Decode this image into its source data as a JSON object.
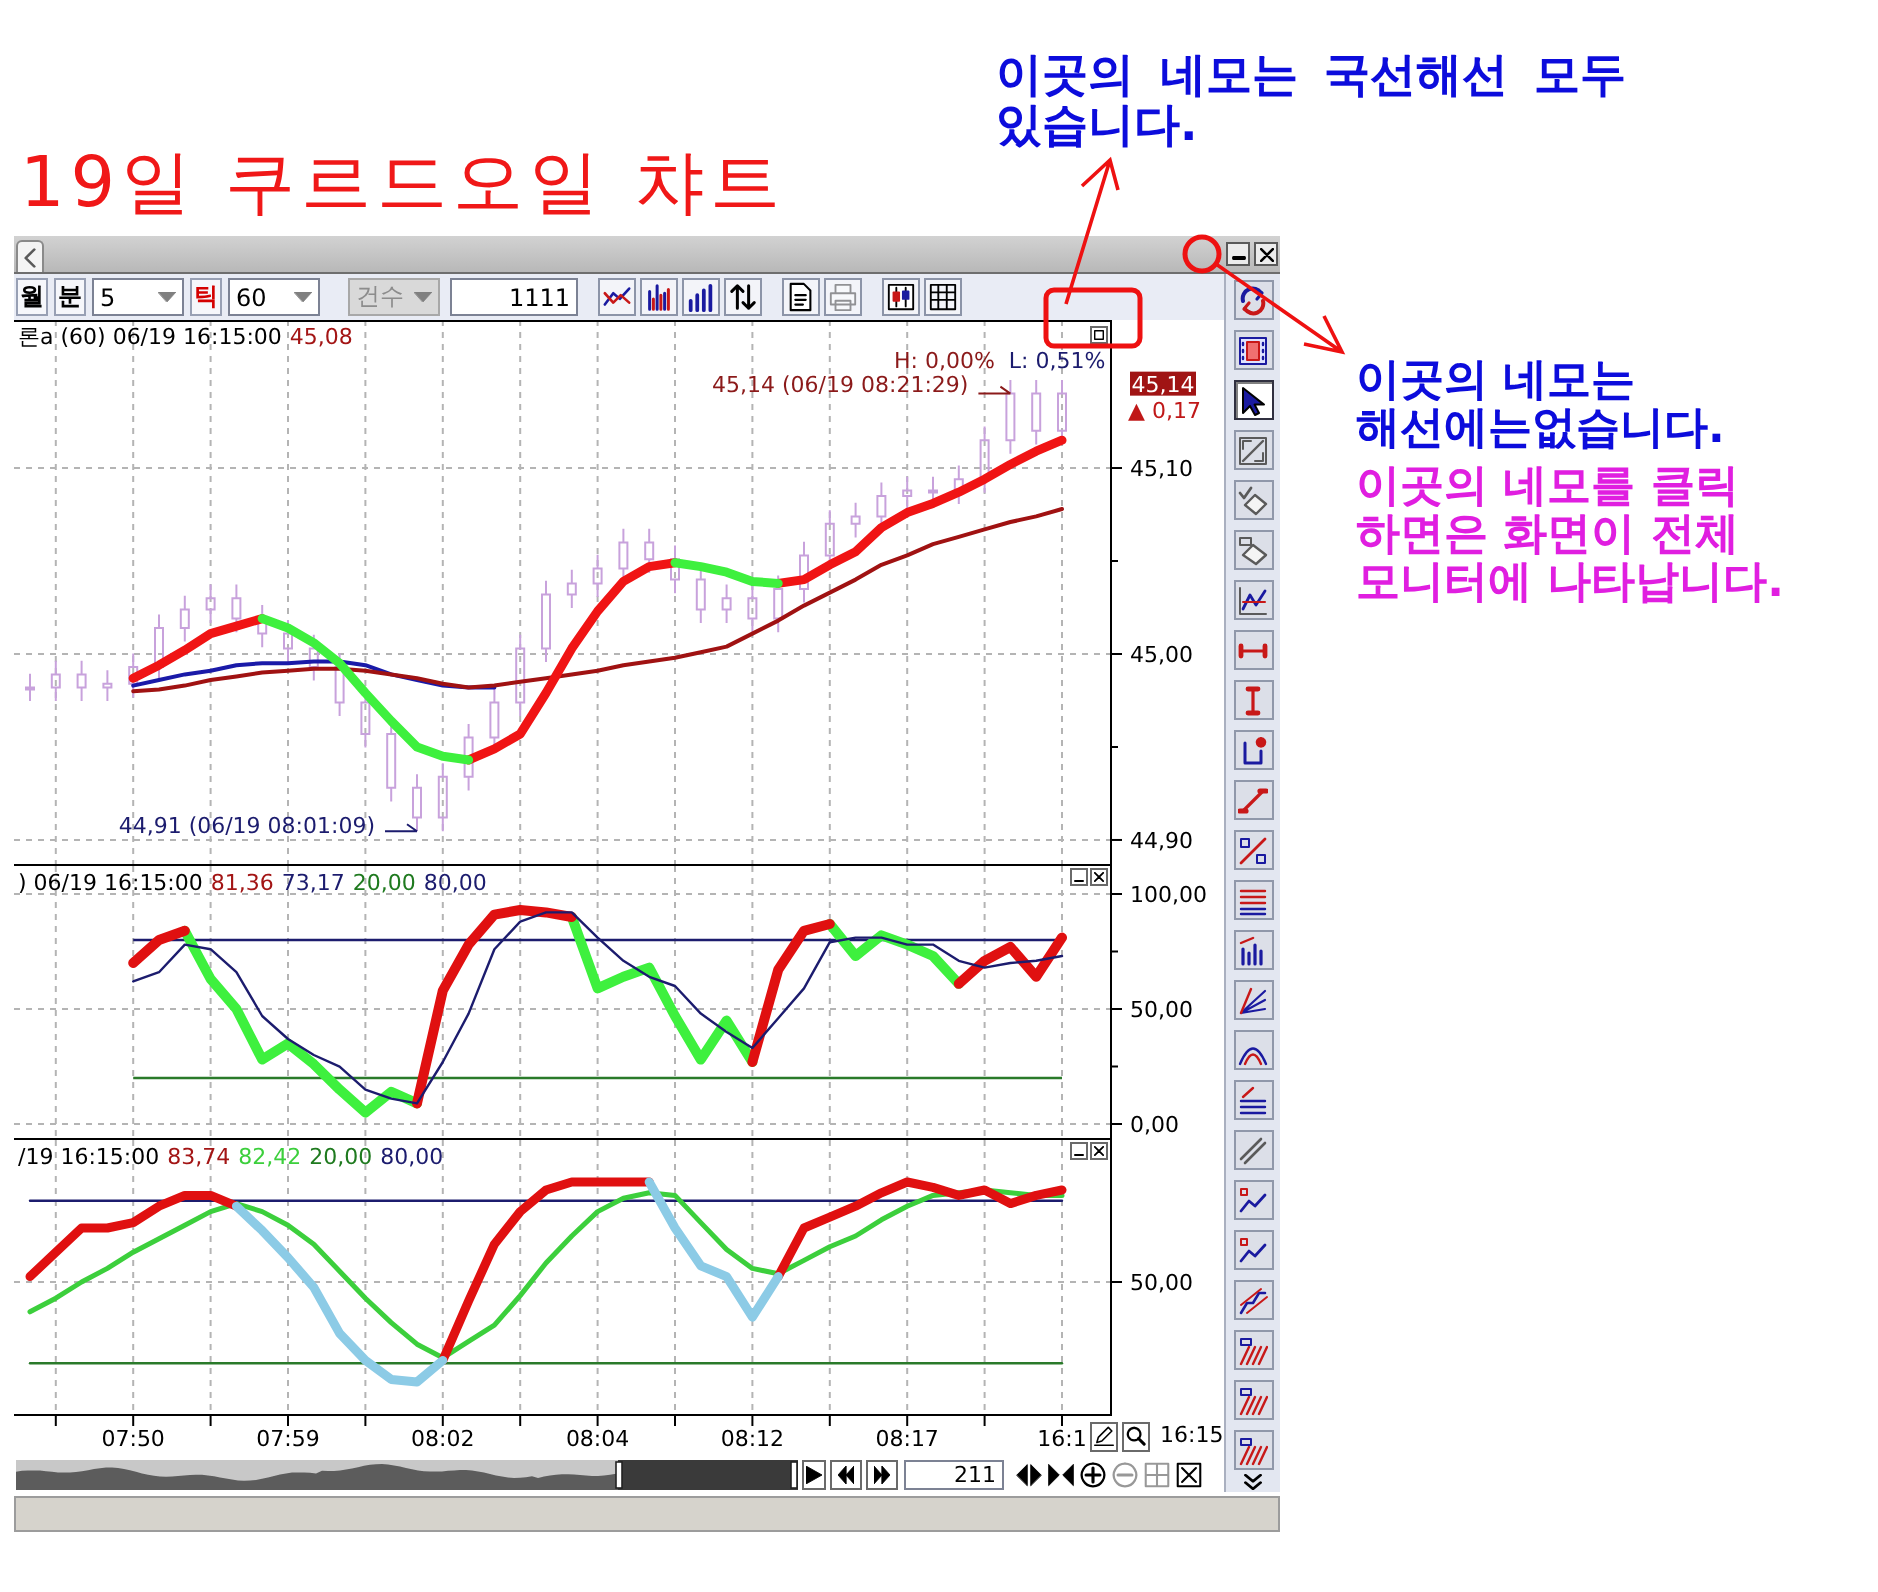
{
  "notes": {
    "title": "19일 쿠르드오일 챠트",
    "top": "이곳의 네모는 국선해선 모두\n있습니다.",
    "side": "이곳의 네모는\n해선에는없습니다.",
    "side_highlight": "이곳의 네모를 클릭\n하면은 화면이 전체\n모니터에 나타납니다."
  },
  "toolbar": {
    "period": [
      {
        "kind": "button",
        "label": "월",
        "selected": false
      },
      {
        "kind": "button",
        "label": "분",
        "selected": false
      },
      {
        "kind": "dropdown",
        "value": "5"
      },
      {
        "kind": "button",
        "label": "틱",
        "selected": true
      },
      {
        "kind": "dropdown",
        "value": "60"
      }
    ],
    "count_mode": {
      "value": "건수",
      "disabled": true
    },
    "count": "1111",
    "icon_groups": [
      {
        "buttons": [
          {
            "kind": "crossing-lines",
            "disabled": false
          },
          {
            "kind": "dotted-bars",
            "disabled": false
          },
          {
            "kind": "bar-chart",
            "disabled": false
          },
          {
            "kind": "up-down-arrows",
            "disabled": false
          }
        ]
      },
      {
        "buttons": [
          {
            "kind": "document",
            "disabled": false
          },
          {
            "kind": "printer",
            "disabled": true
          }
        ]
      },
      {
        "buttons": [
          {
            "kind": "candlesticks",
            "disabled": false
          },
          {
            "kind": "table",
            "disabled": false
          }
        ]
      }
    ]
  },
  "chart": {
    "panes": [
      {
        "legend": [
          {
            "text": "론a (60) 06/19 16:15:00",
            "color": "#000000"
          },
          {
            "text": "45,08",
            "color": "#a31515"
          }
        ],
        "range_labels": [
          {
            "text": "H: 0,00%",
            "color": "#8b1a1a"
          },
          {
            "text": "L: 0,51%",
            "color": "#1c1c6e"
          }
        ],
        "price_tag": {
          "price": "45,14",
          "change": "▲ 0,17"
        },
        "chart_data": {
          "type": "line",
          "grid": true,
          "categories": [
            null,
            null,
            null,
            null,
            null,
            null,
            null,
            null,
            null,
            null,
            null,
            null,
            null,
            null,
            null,
            null,
            null,
            null,
            null,
            null,
            null,
            null,
            null,
            null,
            null,
            null,
            null,
            null,
            null,
            null,
            null,
            null,
            null,
            null,
            null,
            null,
            null
          ],
          "ylim": [
            44.886,
            45.1796
          ],
          "yticks": [
            {
              "value": 44.9,
              "label": "44,90"
            },
            {
              "value": 45,
              "label": "45,00"
            },
            {
              "value": 45.1,
              "label": "45,10"
            }
          ],
          "series": [
            {
              "color": "#1a1aa8",
              "values": [
                44.983,
                44.986,
                44.989,
                44.991,
                44.994,
                44.995,
                44.995,
                44.996,
                44.996,
                44.994,
                44.989,
                44.986,
                44.983,
                44.982,
                44.982,
                null,
                null,
                null,
                null,
                null,
                null,
                null,
                null,
                null,
                null,
                null,
                null,
                null,
                null,
                null,
                null,
                null,
                null,
                null,
                null,
                null,
                null
              ]
            },
            {
              "color": "#a01212",
              "values": [
                44.98,
                44.981,
                44.983,
                44.986,
                44.988,
                44.99,
                44.991,
                44.992,
                44.992,
                44.991,
                44.989,
                44.987,
                44.984,
                44.982,
                44.983,
                44.985,
                44.987,
                44.989,
                44.991,
                44.994,
                44.996,
                44.998,
                45.001,
                45.004,
                45.011,
                45.018,
                45.026,
                45.033,
                45.04,
                45.048,
                45.053,
                45.059,
                45.063,
                45.067,
                45.071,
                45.074,
                45.078
              ]
            },
            {
              "color": "#f01414",
              "values": [
                44.987,
                44.994,
                45.002,
                45.011,
                45.015,
                45.019,
                null,
                null,
                null,
                null,
                null,
                null,
                null,
                44.943,
                44.949,
                44.957,
                44.979,
                45.003,
                45.023,
                45.039,
                45.047,
                45.049,
                null,
                null,
                null,
                45.038,
                45.04,
                45.048,
                45.055,
                45.068,
                45.076,
                45.081,
                45.087,
                45.094,
                45.102,
                45.109,
                45.115
              ]
            },
            {
              "color": "#3ef03e",
              "values": [
                null,
                null,
                null,
                null,
                null,
                45.019,
                45.014,
                45.006,
                44.995,
                44.979,
                44.964,
                44.95,
                44.945,
                44.943,
                null,
                null,
                null,
                null,
                null,
                null,
                null,
                45.049,
                45.047,
                45.044,
                45.039,
                45.038,
                null,
                null,
                null,
                null,
                null,
                null,
                null,
                null,
                null,
                null,
                null
              ]
            }
          ],
          "annotations": [
            "45,14 (06/19 08:21:29)",
            "44,91 (06/19 08:01:09)"
          ]
        }
      },
      {
        "legend": [
          {
            "text": ") 06/19 16:15:00",
            "color": "#000000"
          },
          {
            "text": "81,36",
            "color": "#a31515"
          },
          {
            "text": "73,17",
            "color": "#1c1c6e"
          },
          {
            "text": "20,00",
            "color": "#1f7a1f"
          },
          {
            "text": "80,00",
            "color": "#1c1c6e"
          }
        ],
        "chart_data": {
          "type": "line",
          "grid": true,
          "categories": [
            null,
            null,
            null,
            null,
            null,
            null,
            null,
            null,
            null,
            null,
            null,
            null,
            null,
            null,
            null,
            null,
            null,
            null,
            null,
            null,
            null,
            null,
            null,
            null,
            null,
            null,
            null,
            null,
            null,
            null,
            null,
            null,
            null,
            null,
            null,
            null,
            null
          ],
          "ylim": [
            0,
            100
          ],
          "yticks": [
            {
              "value": 0,
              "label": "0,00"
            },
            {
              "value": 50,
              "label": "50,00"
            },
            {
              "value": 100,
              "label": "100,00"
            }
          ],
          "series": [
            {
              "color": "#1c1c6e",
              "values": [
                80,
                80,
                80,
                80,
                80,
                80,
                80,
                80,
                80,
                80,
                80,
                80,
                80,
                80,
                80,
                80,
                80,
                80,
                80,
                80,
                80,
                80,
                80,
                80,
                80,
                80,
                80,
                80,
                80,
                80,
                80,
                80,
                80,
                80,
                80,
                80,
                80
              ]
            },
            {
              "color": "#2a7a2a",
              "values": [
                20,
                20,
                20,
                20,
                20,
                20,
                20,
                20,
                20,
                20,
                20,
                20,
                20,
                20,
                20,
                20,
                20,
                20,
                20,
                20,
                20,
                20,
                20,
                20,
                20,
                20,
                20,
                20,
                20,
                20,
                20,
                20,
                20,
                20,
                20,
                20,
                20
              ]
            },
            {
              "color": "#3ef03e",
              "values": [
                null,
                null,
                84,
                63,
                50,
                28,
                35,
                26,
                15,
                5,
                14,
                9,
                null,
                null,
                null,
                null,
                null,
                90,
                59,
                64,
                68,
                47,
                28,
                45,
                27,
                null,
                null,
                87,
                73,
                82,
                78,
                73,
                61,
                null,
                null,
                null,
                null
              ]
            },
            {
              "color": "#e01010",
              "values": [
                70,
                80,
                84,
                null,
                null,
                null,
                null,
                null,
                null,
                null,
                null,
                9,
                58,
                78,
                91,
                93,
                92,
                90,
                null,
                null,
                null,
                null,
                null,
                null,
                27,
                67,
                84,
                87,
                null,
                null,
                null,
                null,
                61,
                71,
                77,
                64,
                81
              ]
            },
            {
              "color": "#1c1c6e",
              "values": [
                62,
                66,
                78,
                76,
                66,
                47,
                37,
                30,
                25,
                15,
                11,
                9,
                27,
                48,
                76,
                88,
                92,
                92,
                81,
                71,
                64,
                60,
                48,
                40,
                33,
                46,
                59,
                79,
                81,
                81,
                78,
                78,
                71,
                68,
                70,
                71,
                73
              ]
            }
          ]
        }
      },
      {
        "legend": [
          {
            "text": "/19 16:15:00",
            "color": "#000000"
          },
          {
            "text": "83,74",
            "color": "#a31515"
          },
          {
            "text": "82,42",
            "color": "#3ccf3c"
          },
          {
            "text": "20,00",
            "color": "#1f7a1f"
          },
          {
            "text": "80,00",
            "color": "#1c1c6e"
          }
        ],
        "axis_labels": [
          "50,00"
        ]
      }
    ],
    "time_axis": {
      "labels": [
        "07:50",
        "07:59",
        "08:02",
        "08:04",
        "08:12",
        "08:17",
        "16:1"
      ],
      "end_label": "16:15"
    }
  },
  "navigator": {
    "count": "211",
    "tools": [
      {
        "kind": "outward-triangles",
        "disabled": false
      },
      {
        "kind": "inward-triangles",
        "disabled": false
      },
      {
        "kind": "plus-circle",
        "disabled": false
      },
      {
        "kind": "minus-circle",
        "disabled": true
      },
      {
        "kind": "grid",
        "disabled": true
      },
      {
        "kind": "close-box",
        "disabled": false
      }
    ]
  },
  "drawing_tools": [
    {
      "kind": "sync-arrows",
      "selected": false
    },
    {
      "kind": "film",
      "selected": false
    },
    {
      "kind": "pointer",
      "selected": true
    },
    {
      "kind": "box-diagonal",
      "selected": false
    },
    {
      "kind": "eraser-check",
      "selected": false
    },
    {
      "kind": "eraser",
      "selected": false
    },
    {
      "kind": "zigzag",
      "selected": false
    },
    {
      "kind": "horizontal-line",
      "selected": false
    },
    {
      "kind": "vertical-line",
      "selected": false
    },
    {
      "kind": "marker-line",
      "selected": false
    },
    {
      "kind": "diagonal-line",
      "selected": false
    },
    {
      "kind": "slash",
      "selected": false
    },
    {
      "kind": "horizontal-lines",
      "selected": false
    },
    {
      "kind": "vertical-bars",
      "selected": false
    },
    {
      "kind": "fan-lines",
      "selected": false
    },
    {
      "kind": "arcs",
      "selected": false
    },
    {
      "kind": "stacked-lines",
      "selected": false
    },
    {
      "kind": "parallel-lines",
      "selected": false
    },
    {
      "kind": "trend-line",
      "selected": false
    },
    {
      "kind": "trend-line",
      "selected": false
    },
    {
      "kind": "step-lines",
      "selected": false
    },
    {
      "kind": "hatch",
      "selected": false
    },
    {
      "kind": "hatch",
      "selected": false
    },
    {
      "kind": "hatch",
      "selected": false
    }
  ]
}
